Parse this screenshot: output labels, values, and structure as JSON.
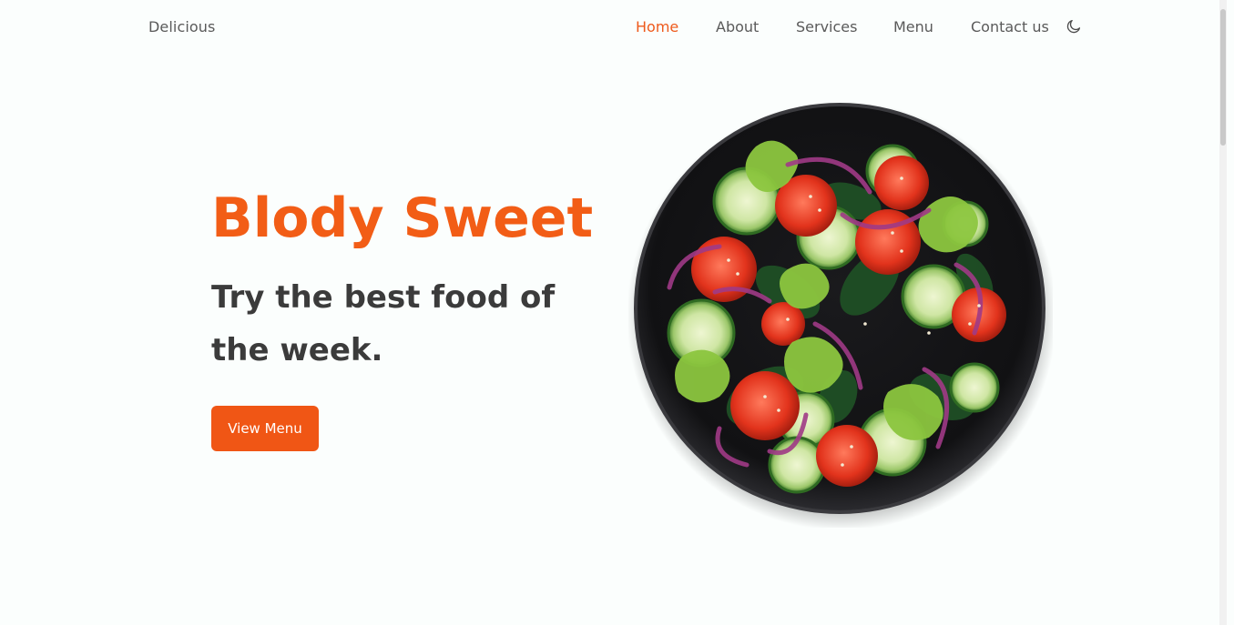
{
  "header": {
    "logo": "Delicious",
    "nav": [
      {
        "label": "Home",
        "active": true
      },
      {
        "label": "About",
        "active": false
      },
      {
        "label": "Services",
        "active": false
      },
      {
        "label": "Menu",
        "active": false
      },
      {
        "label": "Contact us",
        "active": false
      }
    ],
    "theme_toggle_icon": "moon-icon"
  },
  "hero": {
    "title": "Blody Sweet",
    "subtitle": "Try the best food of the week.",
    "cta_label": "View Menu",
    "image_icon": "salad-bowl-image"
  },
  "colors": {
    "accent": "#f25d16",
    "button": "#f05615",
    "text_dark": "#3b3b3b",
    "text_nav": "#5a5a5a",
    "background": "#fbfefd"
  }
}
